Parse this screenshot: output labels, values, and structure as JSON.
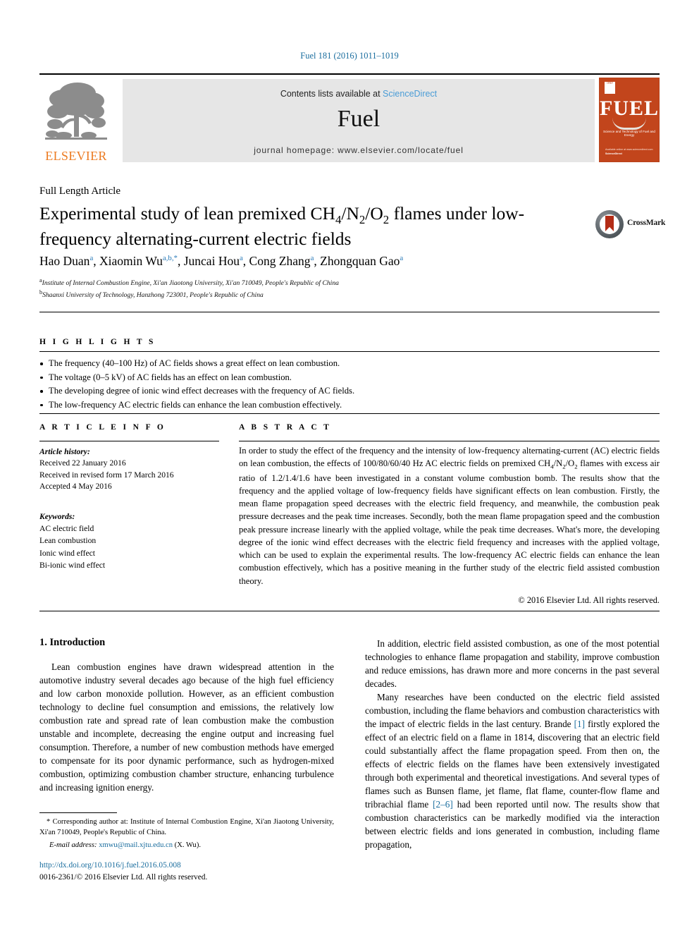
{
  "journal_ref": "Fuel 181 (2016) 1011–1019",
  "masthead": {
    "contents_prefix": "Contents lists available at ",
    "sciencedirect": "ScienceDirect",
    "journal_name": "Fuel",
    "homepage": "journal homepage: www.elsevier.com/locate/fuel",
    "publisher_wordmark": "ELSEVIER",
    "cover": {
      "title": "FUEL",
      "subtitle": "Science and Technology of Fuel and Energy",
      "badge_text": "IFRF",
      "footer_line1": "Available online at www.sciencedirect.com",
      "footer_line2": "ScienceDirect"
    }
  },
  "article": {
    "type": "Full Length Article",
    "title_part1": "Experimental study of lean premixed CH",
    "title_sub1": "4",
    "title_part2": "/N",
    "title_sub2": "2",
    "title_part3": "/O",
    "title_sub3": "2",
    "title_part4": " flames under low-frequency alternating-current electric fields",
    "crossmark_label": "CrossMark"
  },
  "authors": {
    "list": "Hao Duan a, Xiaomin Wu a,b,*, Juncai Hou a, Cong Zhang a, Zhongquan Gao a",
    "affiliation_a": "Institute of Internal Combustion Engine, Xi'an Jiaotong University, Xi'an 710049, People's Republic of China",
    "affiliation_b": "Shaanxi University of Technology, Hanzhong 723001, People's Republic of China"
  },
  "highlights": {
    "heading": "H I G H L I G H T S",
    "items": [
      "The frequency (40–100 Hz) of AC fields shows a great effect on lean combustion.",
      "The voltage (0–5 kV) of AC fields has an effect on lean combustion.",
      "The developing degree of ionic wind effect decreases with the frequency of AC fields.",
      "The low-frequency AC electric fields can enhance the lean combustion effectively."
    ]
  },
  "article_info": {
    "heading": "A R T I C L E  I N F O",
    "history_label": "Article history:",
    "history": [
      "Received 22 January 2016",
      "Received in revised form 17 March 2016",
      "Accepted 4 May 2016"
    ],
    "keywords_label": "Keywords:",
    "keywords": [
      "AC electric field",
      "Lean combustion",
      "Ionic wind effect",
      "Bi-ionic wind effect"
    ]
  },
  "abstract": {
    "heading": "A B S T R A C T",
    "text_part1": "In order to study the effect of the frequency and the intensity of low-frequency alternating-current (AC) electric fields on lean combustion, the effects of 100/80/60/40 Hz AC electric fields on premixed CH",
    "sub1": "4",
    "text_part2": "/N",
    "sub2": "2",
    "text_part3": "/O",
    "sub3": "2",
    "text_part4": " flames with excess air ratio of 1.2/1.4/1.6 have been investigated in a constant volume combustion bomb. The results show that the frequency and the applied voltage of low-frequency fields have significant effects on lean combustion. Firstly, the mean flame propagation speed decreases with the electric field frequency, and meanwhile, the combustion peak pressure decreases and the peak time increases. Secondly, both the mean flame propagation speed and the combustion peak pressure increase linearly with the applied voltage, while the peak time decreases. What's more, the developing degree of the ionic wind effect decreases with the electric field frequency and increases with the applied voltage, which can be used to explain the experimental results. The low-frequency AC electric fields can enhance the lean combustion effectively, which has a positive meaning in the further study of the electric field assisted combustion theory.",
    "copyright": "© 2016 Elsevier Ltd. All rights reserved."
  },
  "body": {
    "intro_title": "1. Introduction",
    "left_paragraph": "Lean combustion engines have drawn widespread attention in the automotive industry several decades ago because of the high fuel efficiency and low carbon monoxide pollution. However, as an efficient combustion technology to decline fuel consumption and emissions, the relatively low combustion rate and spread rate of lean combustion make the combustion unstable and incomplete, decreasing the engine output and increasing fuel consumption. Therefore, a number of new combustion methods have emerged to compensate for its poor dynamic performance, such as hydrogen-mixed combustion, optimizing combustion chamber structure, enhancing turbulence and increasing ignition energy.",
    "right_paragraph1": "In addition, electric field assisted combustion, as one of the most potential technologies to enhance flame propagation and stability, improve combustion and reduce emissions, has drawn more and more concerns in the past several decades.",
    "right_paragraph2_a": "Many researches have been conducted on the electric field assisted combustion, including the flame behaviors and combustion characteristics with the impact of electric fields in the last century. Brande ",
    "citation1": "[1]",
    "right_paragraph2_b": " firstly explored the effect of an electric field on a flame in 1814, discovering that an electric field could substantially affect the flame propagation speed. From then on, the effects of electric fields on the flames have been extensively investigated through both experimental and theoretical investigations. And several types of flames such as Bunsen flame, jet flame, flat flame, counter-flow flame and tribrachial flame ",
    "citation2": "[2–6]",
    "right_paragraph2_c": " had been reported until now. The results show that combustion characteristics can be markedly modified via the interaction between electric fields and ions generated in combustion, including flame propagation,"
  },
  "footnote": {
    "corresponding": "* Corresponding author at: Institute of Internal Combustion Engine, Xi'an Jiaotong University, Xi'an 710049, People's Republic of China.",
    "email_label": "E-mail address:",
    "email": "xmwu@mail.xjtu.edu.cn",
    "email_suffix": " (X. Wu)."
  },
  "footer": {
    "doi": "http://dx.doi.org/10.1016/j.fuel.2016.05.008",
    "issn_line": "0016-2361/© 2016 Elsevier Ltd. All rights reserved."
  },
  "colors": {
    "link_blue": "#1a6d9e",
    "sciencedirect_blue": "#4a9cd6",
    "elsevier_orange": "#ec7b22",
    "cover_red": "#c2451c"
  }
}
